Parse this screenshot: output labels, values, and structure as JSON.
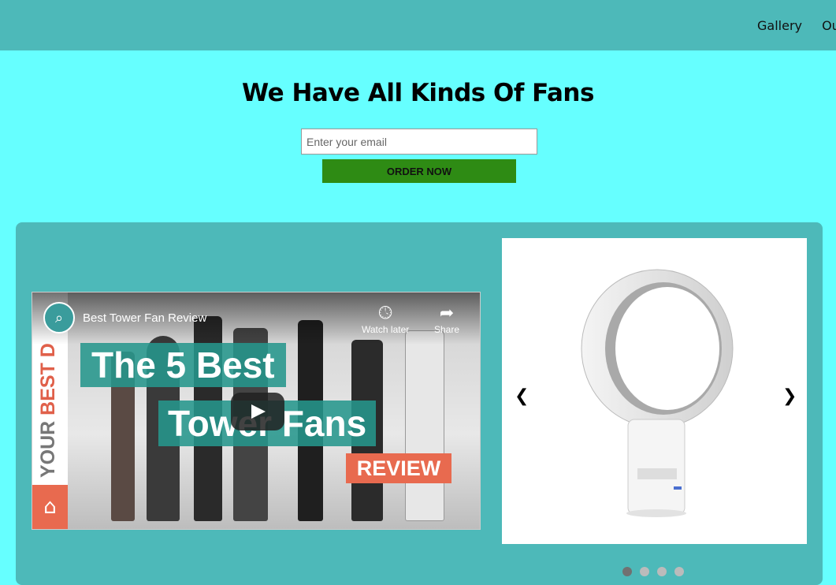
{
  "nav": {
    "items": [
      {
        "label": "Gallery"
      },
      {
        "label": "Our"
      }
    ]
  },
  "hero": {
    "title": "We Have All Kinds Of Fans",
    "email_placeholder": "Enter your email",
    "order_label": "ORDER NOW"
  },
  "video": {
    "title": "Best Tower Fan Review",
    "watch_later": "Watch later",
    "share": "Share",
    "thumb_line1": "The 5 Best",
    "thumb_line2": "Tower Fans",
    "thumb_badge": "REVIEW",
    "channel_prefix": "YOUR ",
    "channel_brand": "BEST D"
  },
  "slider": {
    "prev": "❮",
    "next": "❯",
    "slide_count": 4,
    "active_index": 0
  },
  "colors": {
    "page_bg": "#66ffff",
    "bar_bg": "#4db9b9",
    "button_bg": "#2e8b14"
  }
}
